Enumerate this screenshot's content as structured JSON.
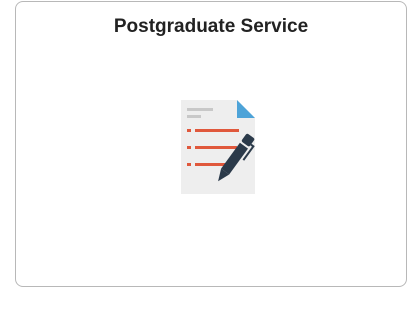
{
  "tile": {
    "title": "Postgraduate Service",
    "icon": "document-form-pen-icon"
  },
  "colors": {
    "border": "#b8b8b8",
    "title_text": "#222222",
    "document_bg": "#eeeeee",
    "document_fold": "#4da3d8",
    "document_lines_gray": "#c8c8c8",
    "document_list_red": "#e0583c",
    "pen_dark": "#2b3a4a"
  }
}
